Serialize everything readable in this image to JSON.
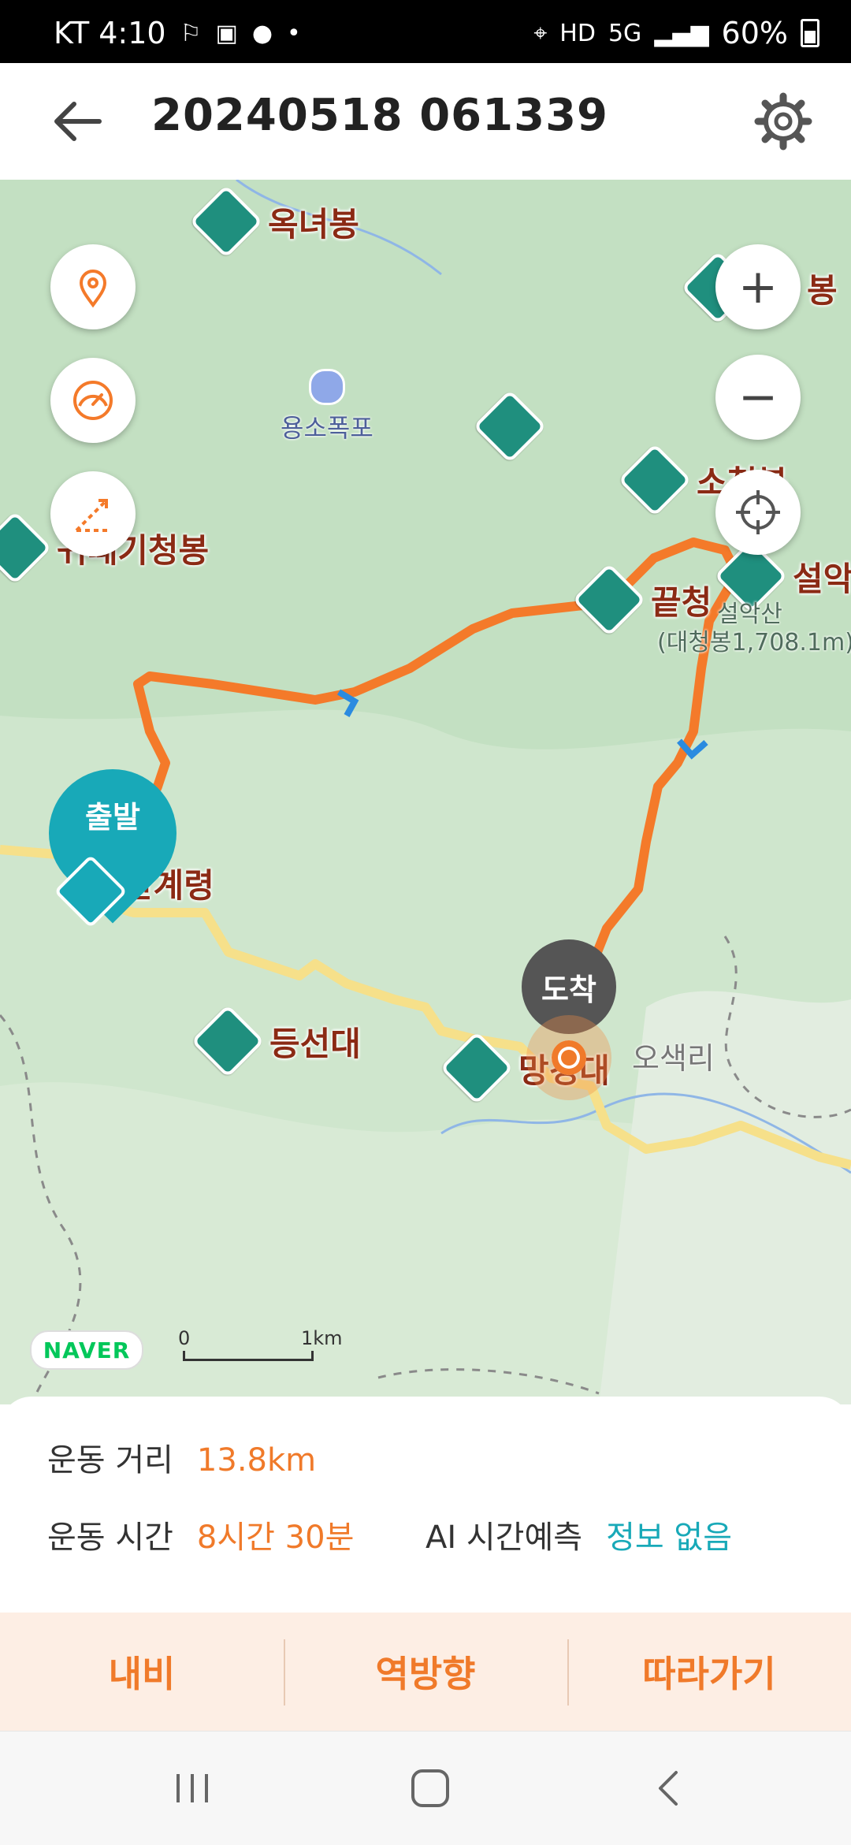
{
  "status_bar": {
    "carrier_time": "KT 4:10",
    "network": "5G",
    "battery": "60%"
  },
  "header": {
    "title": "20240518 061339",
    "back_icon": "arrow-left-icon",
    "settings_icon": "gear-icon"
  },
  "map": {
    "peaks": [
      {
        "name": "옥녀봉"
      },
      {
        "name": "봉"
      },
      {
        "name": "소청봉"
      },
      {
        "name": "귀때기청봉"
      },
      {
        "name": "끝청"
      },
      {
        "name": "설악"
      },
      {
        "name": "등선대"
      },
      {
        "name": "망경대"
      }
    ],
    "places": [
      {
        "name": "용소폭포"
      },
      {
        "name": "한계령"
      },
      {
        "name": "오색리"
      }
    ],
    "mountain_sub": {
      "name": "설악산",
      "height": "(대청봉1,708.1m)"
    },
    "start_marker": "출발",
    "end_marker": "도착",
    "zoom_in": "+",
    "zoom_out": "−",
    "brand": "NAVER",
    "scale": {
      "zero": "0",
      "one": "1km"
    },
    "colors": {
      "route": "#f47a2a",
      "peak": "#1f8f7e",
      "start": "#18a9b8"
    }
  },
  "info": {
    "distance_label": "운동 거리",
    "distance_value": "13.8km",
    "time_label": "운동 시간",
    "time_value": "8시간 30분",
    "ai_label": "AI 시간예측",
    "ai_value": "정보 없음"
  },
  "actions": {
    "navi": "내비",
    "reverse": "역방향",
    "follow": "따라가기"
  }
}
